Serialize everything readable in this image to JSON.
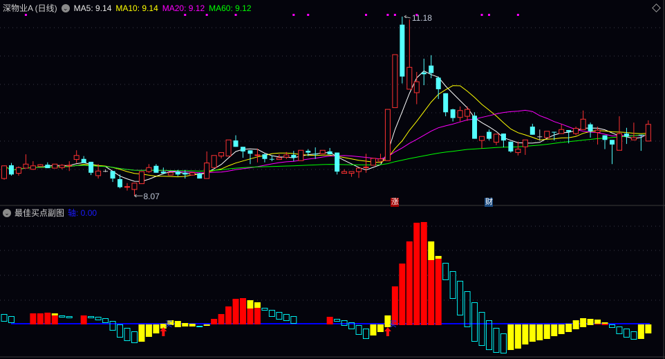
{
  "header": {
    "stock_name": "深物业A (日线)",
    "ma5_label": "MA5: 9.14",
    "ma10_label": "MA10: 9.14",
    "ma20_label": "MA20: 9.12",
    "ma60_label": "MA60: 9.12"
  },
  "sub_header": {
    "title": "最佳买点副图",
    "axis_label": "轴: 0.00"
  },
  "events": [
    {
      "index": 54,
      "label": "涨",
      "color": "#a00000"
    },
    {
      "index": 67,
      "label": "财",
      "color": "#1a4a80"
    }
  ],
  "colors": {
    "up": "#ff3232",
    "down": "#54ffff",
    "doji": "#c8c8c8",
    "ma5": "#ffffff",
    "ma10": "#ffff00",
    "ma20": "#ff00ff",
    "ma60": "#00ff00",
    "axis": "#0000ff",
    "bar_red": "#ff0000",
    "bar_yellow": "#ffff00",
    "bar_cyan": "#00f0f0",
    "dot": "#ff00ff",
    "buy": "#ff1010"
  },
  "chart_data": [
    {
      "type": "candlestick",
      "title": "深物业A (日线)",
      "high_label": "11.18",
      "low_label": "8.07",
      "high_index": 55,
      "low_index": 18,
      "ma_periods": [
        5,
        10,
        20,
        60
      ],
      "signal_dot_indices": [
        3,
        25,
        28,
        32,
        40,
        42,
        50,
        53,
        54,
        57,
        66,
        67,
        71
      ],
      "ohlc": [
        [
          8.37,
          8.59,
          8.35,
          8.59
        ],
        [
          8.6,
          8.64,
          8.42,
          8.44
        ],
        [
          8.46,
          8.58,
          8.42,
          8.56
        ],
        [
          8.55,
          8.79,
          8.55,
          8.62
        ],
        [
          8.53,
          8.67,
          8.52,
          8.59
        ],
        [
          8.58,
          8.62,
          8.58,
          8.61
        ],
        [
          8.61,
          8.65,
          8.55,
          8.55
        ],
        [
          8.55,
          8.62,
          8.55,
          8.62
        ],
        [
          8.56,
          8.62,
          8.53,
          8.6
        ],
        [
          8.59,
          8.67,
          8.5,
          8.6
        ],
        [
          8.7,
          8.86,
          8.64,
          8.77
        ],
        [
          8.71,
          8.76,
          8.64,
          8.64
        ],
        [
          8.66,
          8.66,
          8.43,
          8.47
        ],
        [
          8.42,
          8.62,
          8.37,
          8.5
        ],
        [
          8.5,
          8.53,
          8.48,
          8.5
        ],
        [
          8.5,
          8.5,
          8.31,
          8.37
        ],
        [
          8.36,
          8.44,
          8.2,
          8.22
        ],
        [
          8.22,
          8.29,
          8.16,
          8.23
        ],
        [
          8.18,
          8.29,
          8.07,
          8.29
        ],
        [
          8.28,
          8.49,
          8.28,
          8.49
        ],
        [
          8.49,
          8.62,
          8.47,
          8.56
        ],
        [
          8.59,
          8.62,
          8.47,
          8.47
        ],
        [
          8.49,
          8.56,
          8.46,
          8.46
        ],
        [
          8.43,
          8.47,
          8.43,
          8.47
        ],
        [
          8.49,
          8.52,
          8.41,
          8.44
        ],
        [
          8.47,
          8.52,
          8.37,
          8.44
        ],
        [
          8.43,
          8.48,
          8.42,
          8.47
        ],
        [
          8.46,
          8.47,
          8.37,
          8.37
        ],
        [
          8.37,
          8.84,
          8.37,
          8.64
        ],
        [
          8.56,
          8.77,
          8.56,
          8.77
        ],
        [
          8.76,
          8.82,
          8.72,
          8.82
        ],
        [
          8.76,
          9.04,
          8.76,
          9.04
        ],
        [
          9.03,
          9.12,
          8.92,
          8.92
        ],
        [
          8.92,
          8.92,
          8.73,
          8.84
        ],
        [
          8.86,
          8.86,
          8.62,
          8.8
        ],
        [
          8.77,
          8.89,
          8.65,
          8.78
        ],
        [
          8.79,
          8.8,
          8.65,
          8.71
        ],
        [
          8.71,
          8.77,
          8.67,
          8.7
        ],
        [
          8.7,
          8.79,
          8.7,
          8.73
        ],
        [
          8.74,
          8.83,
          8.71,
          8.78
        ],
        [
          8.78,
          8.85,
          8.67,
          8.73
        ],
        [
          8.68,
          8.86,
          8.68,
          8.86
        ],
        [
          8.85,
          8.88,
          8.76,
          8.82
        ],
        [
          8.8,
          8.91,
          8.71,
          8.79
        ],
        [
          8.8,
          8.86,
          8.8,
          8.86
        ],
        [
          8.84,
          8.9,
          8.79,
          8.79
        ],
        [
          8.82,
          8.82,
          8.44,
          8.49
        ],
        [
          8.46,
          8.53,
          8.46,
          8.49
        ],
        [
          8.46,
          8.49,
          8.4,
          8.49
        ],
        [
          8.49,
          8.55,
          8.38,
          8.55
        ],
        [
          8.56,
          8.8,
          8.47,
          8.57
        ],
        [
          8.6,
          8.72,
          8.6,
          8.72
        ],
        [
          8.67,
          8.8,
          8.67,
          8.71
        ],
        [
          8.68,
          9.57,
          8.68,
          9.57
        ],
        [
          9.6,
          10.52,
          9.6,
          10.52
        ],
        [
          11.04,
          11.18,
          10.02,
          10.14
        ],
        [
          9.92,
          11.13,
          9.92,
          10.3
        ],
        [
          9.86,
          10.22,
          9.66,
          10.05
        ],
        [
          10.21,
          10.45,
          9.99,
          10.18
        ],
        [
          10.33,
          10.51,
          10.11,
          10.2
        ],
        [
          10.12,
          10.14,
          9.75,
          9.92
        ],
        [
          9.85,
          9.85,
          9.45,
          9.52
        ],
        [
          9.57,
          9.58,
          9.36,
          9.42
        ],
        [
          9.43,
          9.62,
          9.36,
          9.55
        ],
        [
          9.45,
          9.62,
          9.37,
          9.57
        ],
        [
          9.46,
          9.52,
          9.06,
          9.06
        ],
        [
          9.03,
          9.1,
          8.89,
          9.1
        ],
        [
          9.18,
          9.22,
          9.03,
          9.06
        ],
        [
          9.0,
          9.14,
          8.95,
          9.14
        ],
        [
          9.15,
          9.15,
          8.91,
          9.03
        ],
        [
          9.01,
          9.01,
          8.82,
          8.84
        ],
        [
          8.82,
          9.01,
          8.77,
          8.88
        ],
        [
          8.92,
          9.04,
          8.78,
          9.04
        ],
        [
          9.27,
          9.32,
          9.13,
          9.13
        ],
        [
          9.1,
          9.22,
          9.03,
          9.1
        ],
        [
          9.08,
          9.19,
          9.08,
          9.19
        ],
        [
          9.18,
          9.18,
          9.03,
          9.17
        ],
        [
          9.15,
          9.31,
          9.15,
          9.22
        ],
        [
          9.21,
          9.21,
          8.98,
          9.18
        ],
        [
          9.15,
          9.27,
          9.12,
          9.24
        ],
        [
          9.22,
          9.55,
          9.22,
          9.4
        ],
        [
          9.31,
          9.34,
          9.08,
          9.19
        ],
        [
          9.17,
          9.27,
          8.96,
          9.21
        ],
        [
          9.12,
          9.12,
          8.88,
          9.04
        ],
        [
          9.04,
          9.04,
          8.62,
          8.96
        ],
        [
          8.86,
          9.45,
          8.86,
          9.15
        ],
        [
          9.15,
          9.25,
          8.97,
          9.1
        ],
        [
          9.04,
          9.34,
          9.04,
          9.08
        ],
        [
          9.13,
          9.13,
          8.85,
          9.12
        ],
        [
          9.02,
          9.38,
          9.02,
          9.31
        ]
      ],
      "ylim": [
        7.78,
        11.47
      ]
    },
    {
      "type": "bar",
      "title": "最佳买点副图",
      "axis_value": 0,
      "ylim": [
        -51,
        153
      ],
      "buy_signal_indices": [
        22,
        53
      ],
      "buy_signal_label": "买",
      "segments": [
        [
          0,
          3,
          14,
          "c"
        ],
        [
          1,
          1,
          11,
          "c"
        ],
        [
          4,
          -1,
          15,
          "r"
        ],
        [
          5,
          -1,
          15,
          "r"
        ],
        [
          6,
          -1,
          16,
          "r"
        ],
        [
          7,
          -1,
          12,
          "r"
        ],
        [
          7,
          12,
          15,
          "y"
        ],
        [
          8,
          9,
          12,
          "c"
        ],
        [
          9,
          8,
          11,
          "c"
        ],
        [
          11,
          -1,
          12,
          "r"
        ],
        [
          12,
          8,
          11,
          "c"
        ],
        [
          13,
          5,
          10,
          "c"
        ],
        [
          14,
          1,
          8,
          "c"
        ],
        [
          15,
          -10,
          4,
          "c"
        ],
        [
          16,
          -20,
          -1,
          "c"
        ],
        [
          17,
          -25,
          -6,
          "c"
        ],
        [
          18,
          -28,
          -11,
          "c"
        ],
        [
          19,
          -26,
          -1,
          "y"
        ],
        [
          20,
          -19,
          -1,
          "y"
        ],
        [
          21,
          -14,
          -1,
          "y"
        ],
        [
          22,
          -7,
          0,
          "y"
        ],
        [
          23,
          -2,
          5,
          "y"
        ],
        [
          24,
          -5,
          4,
          "y"
        ],
        [
          25,
          -4,
          1,
          "y"
        ],
        [
          26,
          -4,
          0,
          "y"
        ],
        [
          27,
          -5,
          -3,
          "cf"
        ],
        [
          28,
          -3,
          -1,
          "y"
        ],
        [
          29,
          -1,
          7,
          "r"
        ],
        [
          30,
          -1,
          14,
          "r"
        ],
        [
          31,
          -1,
          25,
          "r"
        ],
        [
          32,
          -1,
          36,
          "r"
        ],
        [
          33,
          -1,
          37,
          "r"
        ],
        [
          34,
          -1,
          22,
          "r"
        ],
        [
          34,
          22,
          34,
          "y"
        ],
        [
          35,
          -1,
          23,
          "r"
        ],
        [
          35,
          23,
          31,
          "y"
        ],
        [
          36,
          19,
          23,
          "c"
        ],
        [
          37,
          10,
          20,
          "c"
        ],
        [
          38,
          6,
          17,
          "c"
        ],
        [
          39,
          4,
          14,
          "c"
        ],
        [
          40,
          0,
          11,
          "c"
        ],
        [
          45,
          -1,
          10,
          "r"
        ],
        [
          46,
          3,
          7,
          "c"
        ],
        [
          47,
          -3,
          5,
          "c"
        ],
        [
          48,
          -8,
          2,
          "c"
        ],
        [
          49,
          -16,
          -2,
          "c"
        ],
        [
          50,
          -22,
          -7,
          "c"
        ],
        [
          51,
          -17,
          -1,
          "y"
        ],
        [
          52,
          -12,
          -1,
          "y"
        ],
        [
          53,
          -5,
          12,
          "y"
        ],
        [
          54,
          -2,
          54,
          "r"
        ],
        [
          55,
          -2,
          87,
          "r"
        ],
        [
          56,
          -2,
          119,
          "r"
        ],
        [
          57,
          -2,
          146,
          "r"
        ],
        [
          58,
          -2,
          147,
          "r"
        ],
        [
          59,
          -2,
          92,
          "r"
        ],
        [
          59,
          92,
          119,
          "y"
        ],
        [
          60,
          -2,
          94,
          "r"
        ],
        [
          60,
          94,
          98,
          "y"
        ],
        [
          61,
          63,
          88,
          "c"
        ],
        [
          62,
          36,
          76,
          "c"
        ],
        [
          63,
          12,
          62,
          "c"
        ],
        [
          64,
          -5,
          47,
          "c"
        ],
        [
          65,
          -26,
          31,
          "c"
        ],
        [
          66,
          -32,
          17,
          "c"
        ],
        [
          67,
          -38,
          5,
          "c"
        ],
        [
          68,
          -42,
          -6,
          "c"
        ],
        [
          69,
          -43,
          -14,
          "c"
        ],
        [
          70,
          -38,
          -1,
          "y"
        ],
        [
          71,
          -36,
          -1,
          "y"
        ],
        [
          72,
          -30,
          -1,
          "y"
        ],
        [
          73,
          -26,
          -1,
          "y"
        ],
        [
          74,
          -24,
          -1,
          "y"
        ],
        [
          75,
          -22,
          -1,
          "y"
        ],
        [
          76,
          -18,
          -1,
          "y"
        ],
        [
          77,
          -15,
          -1,
          "y"
        ],
        [
          78,
          -12,
          0,
          "y"
        ],
        [
          79,
          -8,
          5,
          "y"
        ],
        [
          80,
          -5,
          8,
          "y"
        ],
        [
          81,
          -2,
          7,
          "y"
        ],
        [
          82,
          0,
          6,
          "y"
        ],
        [
          82,
          -1,
          0,
          "r"
        ],
        [
          83,
          0,
          2,
          "y"
        ],
        [
          83,
          -2,
          0,
          "r"
        ],
        [
          84,
          -6,
          -1,
          "c"
        ],
        [
          85,
          -15,
          -4,
          "c"
        ],
        [
          86,
          -20,
          -7,
          "c"
        ],
        [
          87,
          -23,
          -11,
          "c"
        ],
        [
          88,
          -22,
          -1,
          "y"
        ],
        [
          89,
          -14,
          -1,
          "y"
        ]
      ]
    }
  ]
}
